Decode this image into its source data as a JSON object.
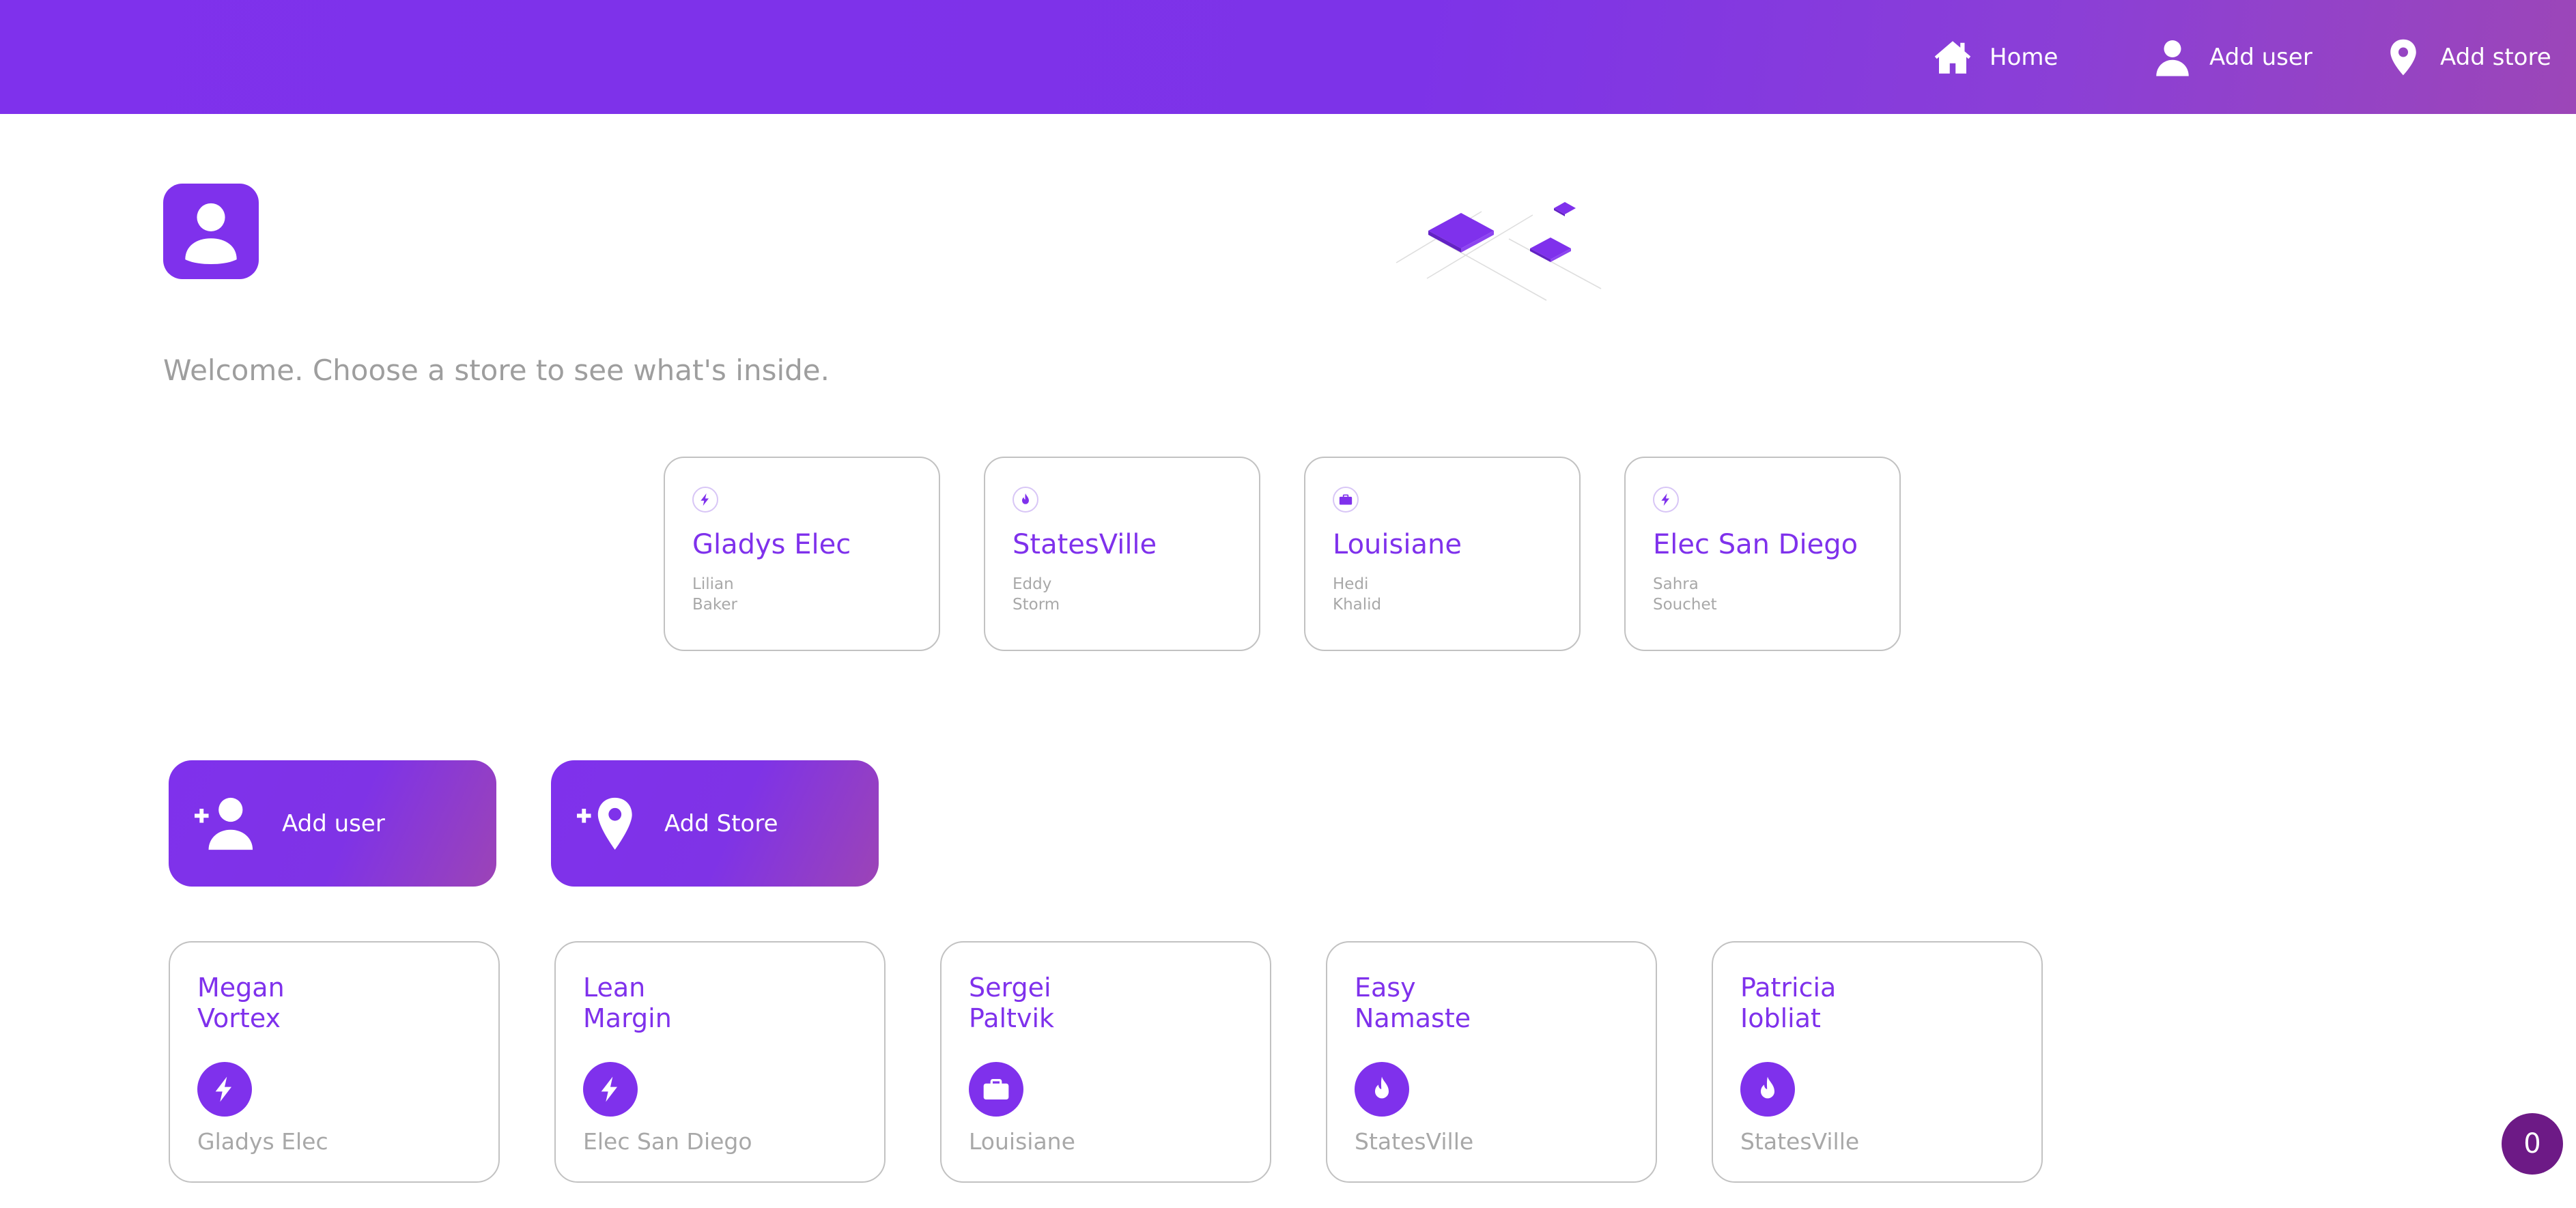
{
  "nav": {
    "home_label": "Home",
    "add_user_label": "Add user",
    "add_store_label": "Add store"
  },
  "welcome_text": "Welcome. Choose a store to see what's inside.",
  "stores": [
    {
      "name": "Gladys Elec",
      "owner_first": "Lilian",
      "owner_last": "Baker",
      "icon": "lightning-icon"
    },
    {
      "name": "StatesVille",
      "owner_first": "Eddy",
      "owner_last": "Storm",
      "icon": "flame-icon"
    },
    {
      "name": "Louisiane",
      "owner_first": "Hedi",
      "owner_last": "Khalid",
      "icon": "briefcase-icon"
    },
    {
      "name": "Elec San Diego",
      "owner_first": "Sahra",
      "owner_last": "Souchet",
      "icon": "lightning-icon"
    }
  ],
  "actions": {
    "add_user_label": "Add user",
    "add_store_label": "Add Store"
  },
  "users": [
    {
      "first": "Megan",
      "last": "Vortex",
      "store": "Gladys Elec",
      "icon": "lightning-icon"
    },
    {
      "first": "Lean",
      "last": "Margin",
      "store": "Elec San Diego",
      "icon": "lightning-icon"
    },
    {
      "first": "Sergei",
      "last": "Paltvik",
      "store": "Louisiane",
      "icon": "briefcase-icon"
    },
    {
      "first": "Easy",
      "last": "Namaste",
      "store": "StatesVille",
      "icon": "flame-icon"
    },
    {
      "first": "Patricia",
      "last": "Iobliat",
      "store": "StatesVille",
      "icon": "flame-icon"
    }
  ],
  "counter": "0",
  "colors": {
    "accent": "#7f31ec",
    "accent_end": "#9c44b6",
    "muted_text": "#9e9e9e",
    "card_border": "#c2c2c2",
    "counter_bg": "#6d1a86"
  }
}
